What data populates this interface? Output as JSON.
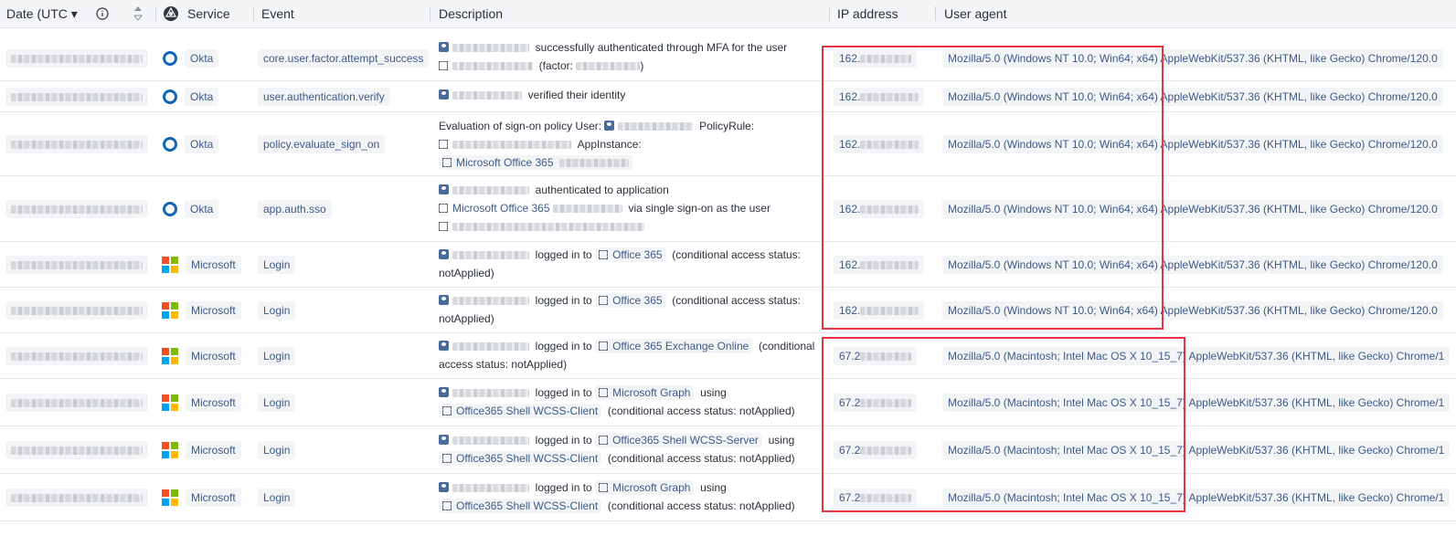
{
  "header": {
    "date": "Date (UTC",
    "service": "Service",
    "event": "Event",
    "description": "Description",
    "ip": "IP address",
    "ua": "User agent"
  },
  "text": {
    "mfa_a": "successfully authenticated through MFA for the user",
    "mfa_b": "(factor:",
    "mfa_c": ")",
    "verified": "verified their identity",
    "eval_a": "Evaluation of sign-on policy User:",
    "eval_b": "PolicyRule:",
    "eval_c": "AppInstance:",
    "auth_app": "authenticated to application",
    "via_sso": "via single sign-on as the user",
    "logged": "logged in to",
    "cas_a": "(conditional access status:",
    "not_applied": "notApplied)",
    "cond": "(conditional",
    "access_status": "access status: notApplied)",
    "using": "using",
    "cas_full": "(conditional access status: notApplied)"
  },
  "apps": {
    "o365": "Office 365",
    "mso365": "Microsoft Office 365",
    "o365exo": "Office 365 Exchange Online",
    "graph": "Microsoft Graph",
    "shell_client": "Office365 Shell WCSS-Client",
    "shell_server": "Office365 Shell WCSS-Server"
  },
  "rows": [
    {
      "service": "Okta",
      "event": "core.user.factor.attempt_success",
      "ip": "162.",
      "ua": "Mozilla/5.0 (Windows NT 10.0; Win64; x64) AppleWebKit/537.36 (KHTML, like Gecko) Chrome/120.0"
    },
    {
      "service": "Okta",
      "event": "user.authentication.verify",
      "ip": "162.",
      "ua": "Mozilla/5.0 (Windows NT 10.0; Win64; x64) AppleWebKit/537.36 (KHTML, like Gecko) Chrome/120.0"
    },
    {
      "service": "Okta",
      "event": "policy.evaluate_sign_on",
      "ip": "162.",
      "ua": "Mozilla/5.0 (Windows NT 10.0; Win64; x64) AppleWebKit/537.36 (KHTML, like Gecko) Chrome/120.0"
    },
    {
      "service": "Okta",
      "event": "app.auth.sso",
      "ip": "162.",
      "ua": "Mozilla/5.0 (Windows NT 10.0; Win64; x64) AppleWebKit/537.36 (KHTML, like Gecko) Chrome/120.0"
    },
    {
      "service": "Microsoft",
      "event": "Login",
      "ip": "162.",
      "ua": "Mozilla/5.0 (Windows NT 10.0; Win64; x64) AppleWebKit/537.36 (KHTML, like Gecko) Chrome/120.0"
    },
    {
      "service": "Microsoft",
      "event": "Login",
      "ip": "162.",
      "ua": "Mozilla/5.0 (Windows NT 10.0; Win64; x64) AppleWebKit/537.36 (KHTML, like Gecko) Chrome/120.0"
    },
    {
      "service": "Microsoft",
      "event": "Login",
      "ip": "67.2",
      "ua": "Mozilla/5.0 (Macintosh; Intel Mac OS X 10_15_7) AppleWebKit/537.36 (KHTML, like Gecko) Chrome/1"
    },
    {
      "service": "Microsoft",
      "event": "Login",
      "ip": "67.2",
      "ua": "Mozilla/5.0 (Macintosh; Intel Mac OS X 10_15_7) AppleWebKit/537.36 (KHTML, like Gecko) Chrome/1"
    },
    {
      "service": "Microsoft",
      "event": "Login",
      "ip": "67.2",
      "ua": "Mozilla/5.0 (Macintosh; Intel Mac OS X 10_15_7) AppleWebKit/537.36 (KHTML, like Gecko) Chrome/1"
    },
    {
      "service": "Microsoft",
      "event": "Login",
      "ip": "67.2",
      "ua": "Mozilla/5.0 (Macintosh; Intel Mac OS X 10_15_7) AppleWebKit/537.36 (KHTML, like Gecko) Chrome/1"
    }
  ],
  "colors": {
    "accent": "#3c5a8a",
    "highlight": "#e8323f",
    "okta": "#1366b2"
  },
  "icons": {
    "date_sort": "caret-down-icon",
    "info": "info-icon",
    "sort": "sort-icon",
    "service": "service-icon",
    "okta": "okta-logo-icon",
    "microsoft": "microsoft-logo-icon",
    "user": "user-icon",
    "app": "app-icon"
  }
}
